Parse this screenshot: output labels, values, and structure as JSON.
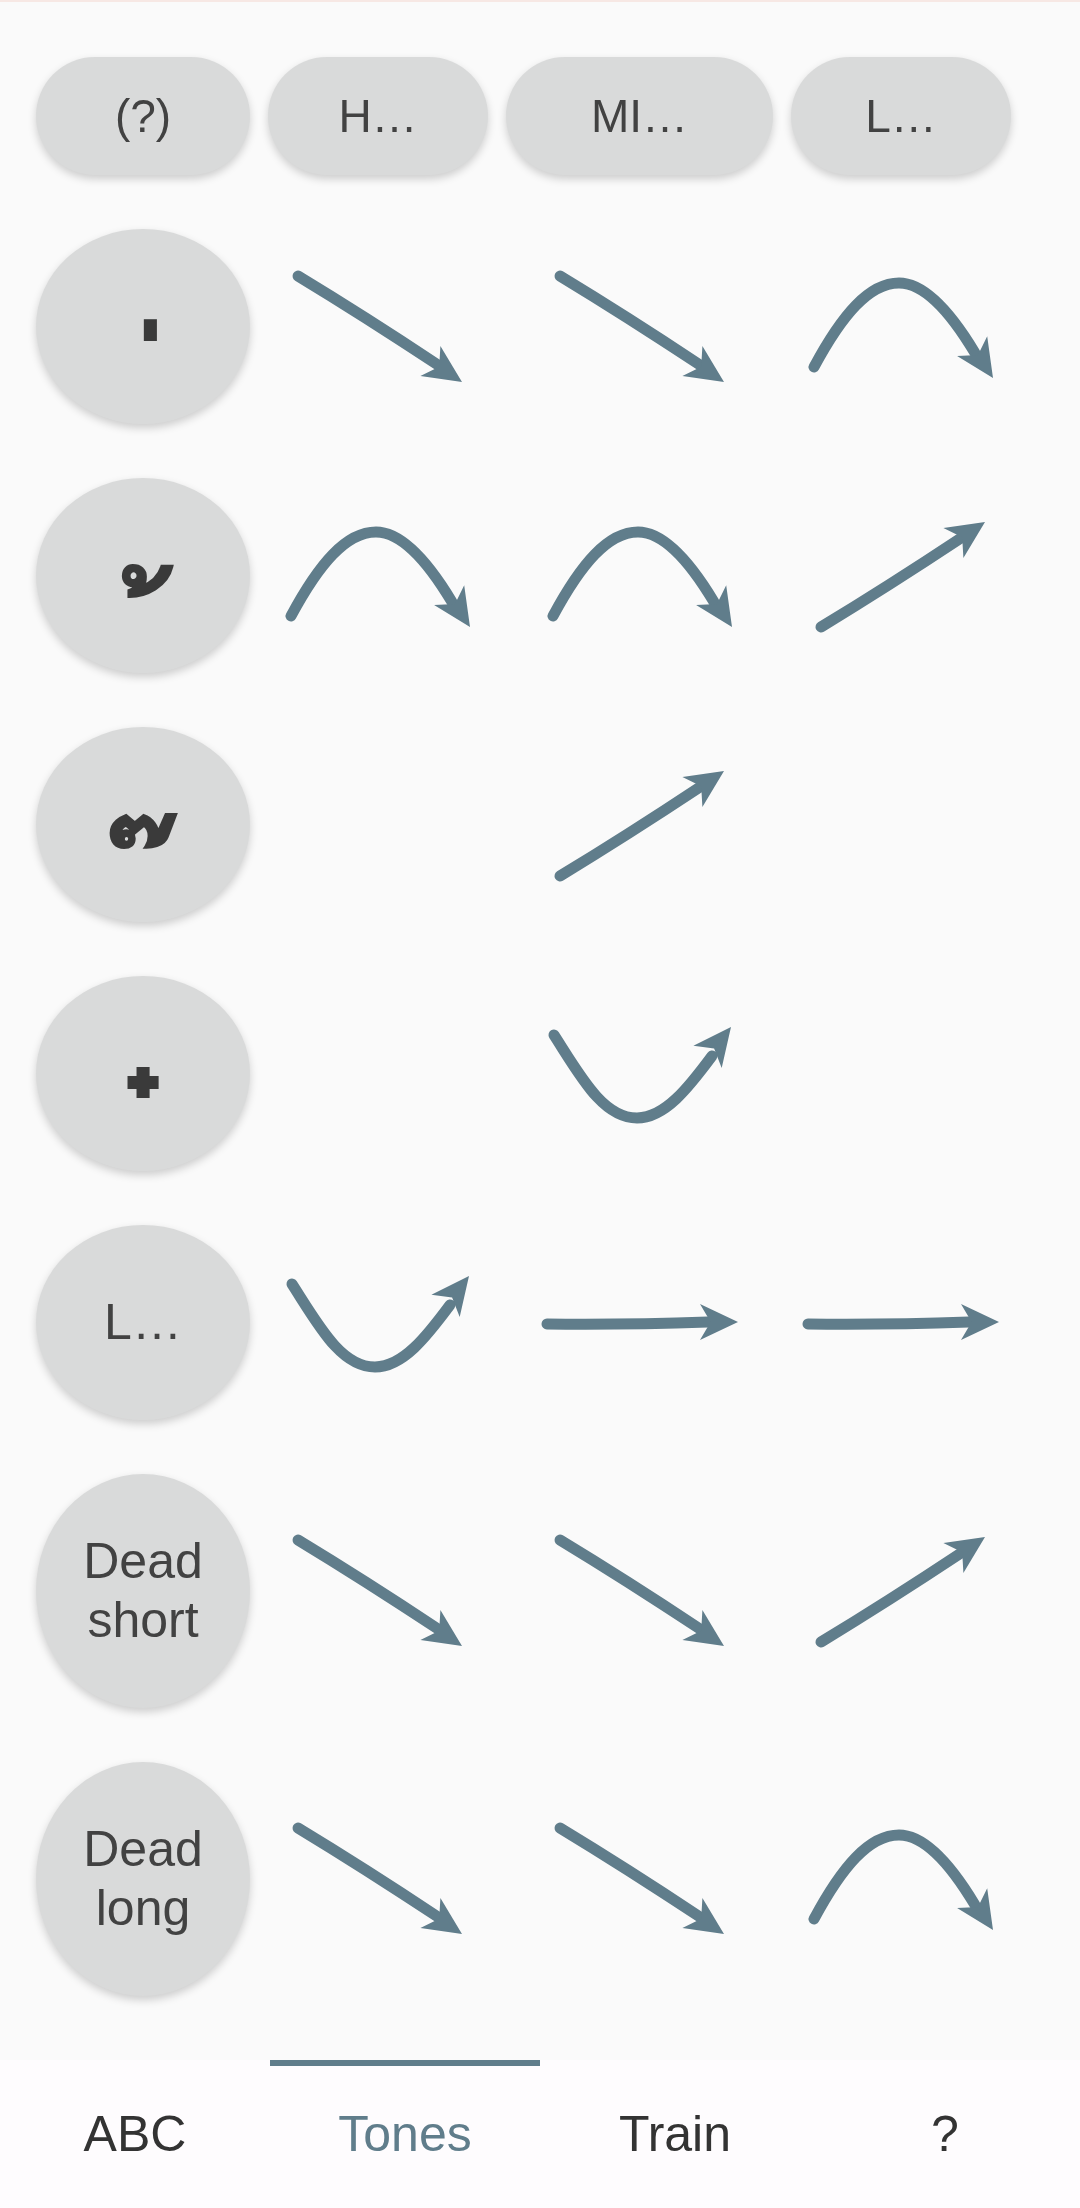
{
  "column_headers": [
    {
      "label": "(?)"
    },
    {
      "label": "H…"
    },
    {
      "label": "MI…"
    },
    {
      "label": "L…"
    }
  ],
  "rows": [
    {
      "kind": "mark",
      "label": "่",
      "cells": [
        {
          "kind": "descending"
        },
        {
          "kind": "descending"
        },
        {
          "kind": "arch"
        }
      ]
    },
    {
      "kind": "mark",
      "label": "้",
      "cells": [
        {
          "kind": "arch"
        },
        {
          "kind": "arch"
        },
        {
          "kind": "ascending"
        }
      ]
    },
    {
      "kind": "mark",
      "label": "๊",
      "cells": [
        null,
        {
          "kind": "ascending"
        },
        null
      ]
    },
    {
      "kind": "mark",
      "label": "๋",
      "cells": [
        null,
        {
          "kind": "dip"
        },
        null
      ]
    },
    {
      "kind": "text",
      "label": "L…",
      "cells": [
        {
          "kind": "dip"
        },
        {
          "kind": "level"
        },
        {
          "kind": "level"
        }
      ]
    },
    {
      "kind": "text",
      "label": "Dead short",
      "cells": [
        {
          "kind": "descending"
        },
        {
          "kind": "descending"
        },
        {
          "kind": "ascending"
        }
      ]
    },
    {
      "kind": "text",
      "label": "Dead long",
      "cells": [
        {
          "kind": "descending"
        },
        {
          "kind": "descending"
        },
        {
          "kind": "arch"
        }
      ]
    }
  ],
  "bottom_nav": [
    {
      "label": "ABC",
      "selected": false
    },
    {
      "label": "Tones",
      "selected": true
    },
    {
      "label": "Train",
      "selected": false
    },
    {
      "label": "?",
      "selected": false
    }
  ]
}
